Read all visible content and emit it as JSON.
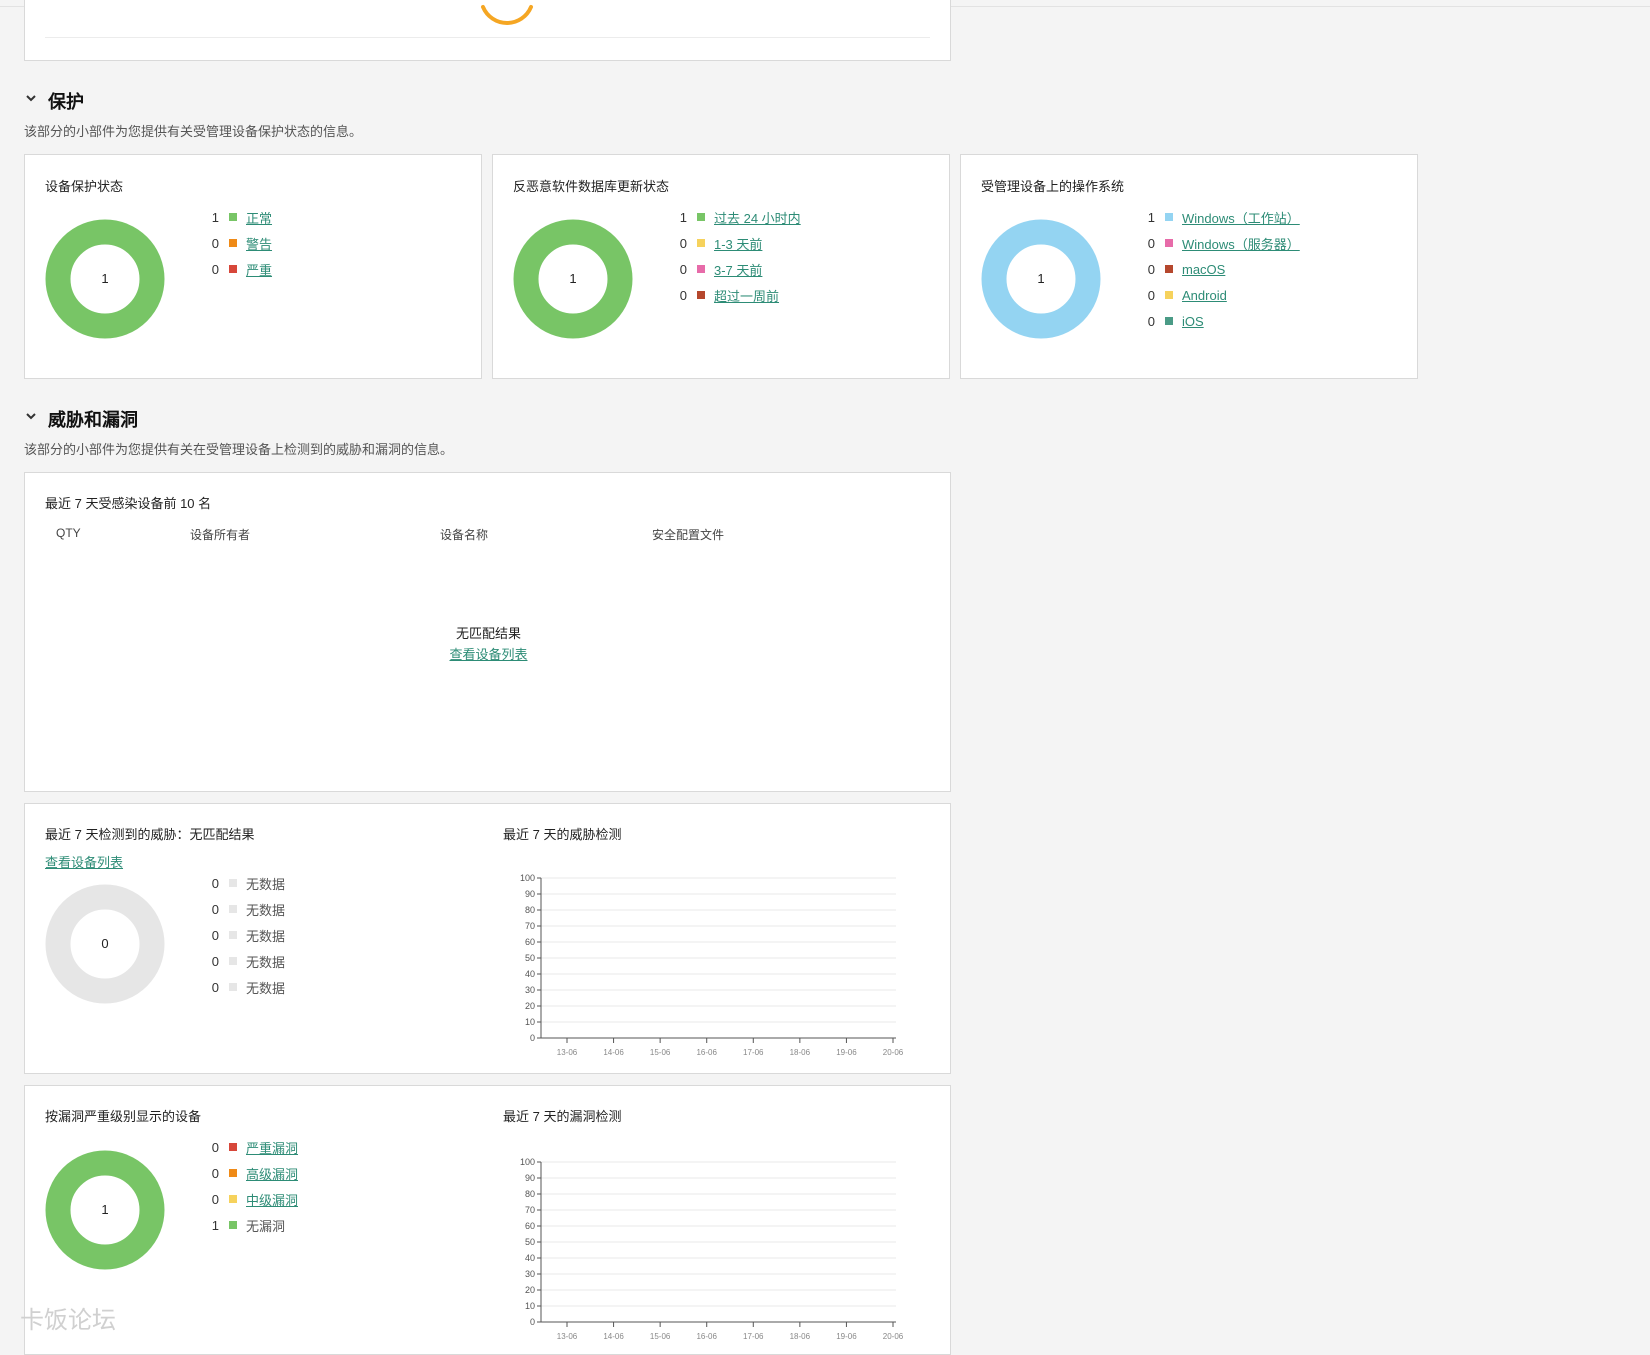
{
  "colors": {
    "green": "#78c566",
    "orange": "#ef8a17",
    "red": "#d7473a",
    "yellow": "#f6d25c",
    "pink": "#e76ba9",
    "brown": "#b5472d",
    "lightblue": "#94d4f2",
    "teal": "#2d8c76",
    "gray": "#e6e6e6",
    "loader": "#f5a623"
  },
  "protection": {
    "title": "保护",
    "desc": "该部分的小部件为您提供有关受管理设备保护状态的信息。",
    "status_widget": {
      "title": "设备保护状态",
      "center": "1",
      "items": [
        {
          "count": "1",
          "label": "正常",
          "color": "#78c566"
        },
        {
          "count": "0",
          "label": "警告",
          "color": "#ef8a17"
        },
        {
          "count": "0",
          "label": "严重",
          "color": "#d7473a"
        }
      ]
    },
    "db_widget": {
      "title": "反恶意软件数据库更新状态",
      "center": "1",
      "items": [
        {
          "count": "1",
          "label": "过去 24 小时内",
          "color": "#78c566"
        },
        {
          "count": "0",
          "label": "1-3 天前",
          "color": "#f6d25c"
        },
        {
          "count": "0",
          "label": "3-7 天前",
          "color": "#e76ba9"
        },
        {
          "count": "0",
          "label": "超过一周前",
          "color": "#b5472d"
        }
      ]
    },
    "os_widget": {
      "title": "受管理设备上的操作系统",
      "center": "1",
      "items": [
        {
          "count": "1",
          "label": "Windows（工作站）",
          "color": "#94d4f2"
        },
        {
          "count": "0",
          "label": "Windows（服务器）",
          "color": "#e76ba9"
        },
        {
          "count": "0",
          "label": "macOS",
          "color": "#b5472d"
        },
        {
          "count": "0",
          "label": "Android",
          "color": "#f6d25c"
        },
        {
          "count": "0",
          "label": "iOS",
          "color": "#4a9b86"
        }
      ]
    }
  },
  "threats": {
    "title": "威胁和漏洞",
    "desc": "该部分的小部件为您提供有关在受管理设备上检测到的威胁和漏洞的信息。",
    "top10": {
      "title": "最近 7 天受感染设备前 10 名",
      "columns": [
        "QTY",
        "设备所有者",
        "设备名称",
        "安全配置文件"
      ],
      "empty": "无匹配结果",
      "link": "查看设备列表"
    },
    "detected": {
      "title": "最近 7 天检测到的威胁：无匹配结果",
      "link": "查看设备列表",
      "center": "0",
      "items": [
        {
          "count": "0",
          "label": "无数据"
        },
        {
          "count": "0",
          "label": "无数据"
        },
        {
          "count": "0",
          "label": "无数据"
        },
        {
          "count": "0",
          "label": "无数据"
        },
        {
          "count": "0",
          "label": "无数据"
        }
      ]
    },
    "threat_chart": {
      "title": "最近 7 天的威胁检测"
    },
    "vuln": {
      "title": "按漏洞严重级别显示的设备",
      "center": "1",
      "items": [
        {
          "count": "0",
          "label": "严重漏洞",
          "color": "#d7473a",
          "link": true
        },
        {
          "count": "0",
          "label": "高级漏洞",
          "color": "#ef8a17",
          "link": true
        },
        {
          "count": "0",
          "label": "中级漏洞",
          "color": "#f6d25c",
          "link": true
        },
        {
          "count": "1",
          "label": "无漏洞",
          "color": "#78c566",
          "link": false
        }
      ]
    },
    "vuln_chart": {
      "title": "最近 7 天的漏洞检测"
    }
  },
  "chart_data": [
    {
      "type": "line",
      "title": "最近 7 天的威胁检测",
      "x": [
        "13-06",
        "14-06",
        "15-06",
        "16-06",
        "17-06",
        "18-06",
        "19-06",
        "20-06"
      ],
      "series": [],
      "ylim": [
        0,
        100
      ],
      "yticks": [
        0,
        10,
        20,
        30,
        40,
        50,
        60,
        70,
        80,
        90,
        100
      ],
      "grid": true
    },
    {
      "type": "line",
      "title": "最近 7 天的漏洞检测",
      "x": [
        "13-06",
        "14-06",
        "15-06",
        "16-06",
        "17-06",
        "18-06",
        "19-06",
        "20-06"
      ],
      "series": [],
      "ylim": [
        0,
        100
      ],
      "yticks": [
        0,
        10,
        20,
        30,
        40,
        50,
        60,
        70,
        80,
        90,
        100
      ],
      "grid": true
    }
  ],
  "watermark": "卡饭论坛"
}
